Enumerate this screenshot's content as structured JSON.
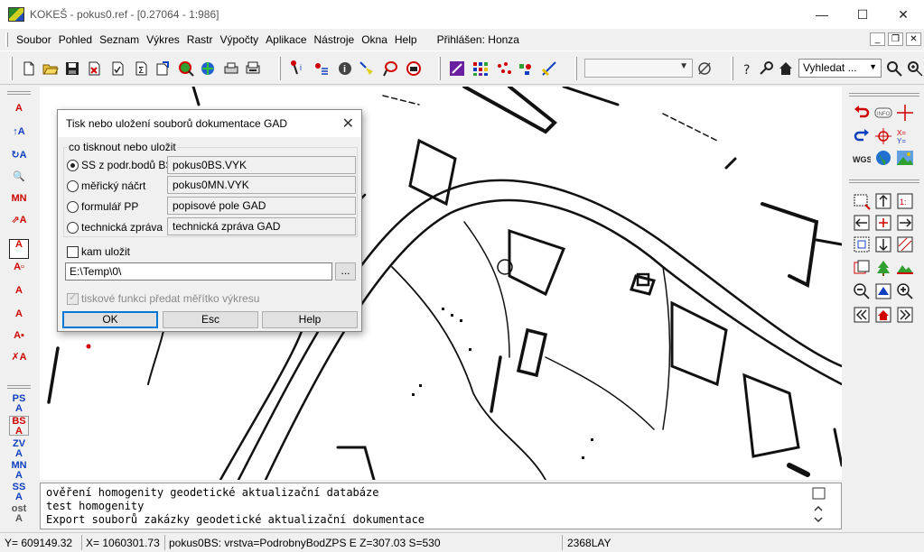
{
  "window": {
    "title": "KOKEŠ - pokus0.ref - [0.27064 - 1:986]",
    "minimize": "—",
    "maximize": "☐",
    "close": "✕"
  },
  "menu": {
    "items": [
      "Soubor",
      "Pohled",
      "Seznam",
      "Výkres",
      "Rastr",
      "Výpočty",
      "Aplikace",
      "Nástroje",
      "Okna",
      "Help"
    ],
    "logged_in": "Přihlášen: Honza"
  },
  "toolbar": {
    "search_placeholder": "Vyhledat ..."
  },
  "left_palette": {
    "layer_labels": [
      "PS",
      "BS",
      "ZV",
      "MN",
      "SS",
      "ost"
    ]
  },
  "dialog": {
    "title": "Tisk nebo uložení souborů dokumentace GAD",
    "group_label": "co tisknout nebo uložit",
    "options": [
      {
        "label": "SS z podr.bodů BS",
        "value": "pokus0BS.VYK",
        "checked": true
      },
      {
        "label": "měřický náčrt",
        "value": "pokus0MN.VYK",
        "checked": false
      },
      {
        "label": "formulář PP",
        "value": "popisové pole GAD",
        "checked": false
      },
      {
        "label": "technická zpráva",
        "value": "technická zpráva GAD",
        "checked": false
      }
    ],
    "save_checkbox_label": "kam uložit",
    "save_path": "E:\\Temp\\0\\",
    "browse_label": "...",
    "scale_checkbox_label": "tiskové funkci předat měřítko výkresu",
    "buttons": {
      "ok": "OK",
      "esc": "Esc",
      "help": "Help"
    }
  },
  "log": {
    "lines": [
      "ověření homogenity geodetické aktualizační databáze",
      "test homogenity",
      "Export souborů zakázky geodetické aktualizační dokumentace"
    ]
  },
  "status": {
    "y": "Y=   609149.32",
    "x": "X=  1060301.73",
    "info": "pokus0BS: vrstva=PodrobnyBodZPS E  Z=307.03 S=530",
    "layer": "2368LAY"
  },
  "colors": {
    "accent": "#0078d7",
    "red": "#d00000",
    "blue": "#1040c0"
  }
}
